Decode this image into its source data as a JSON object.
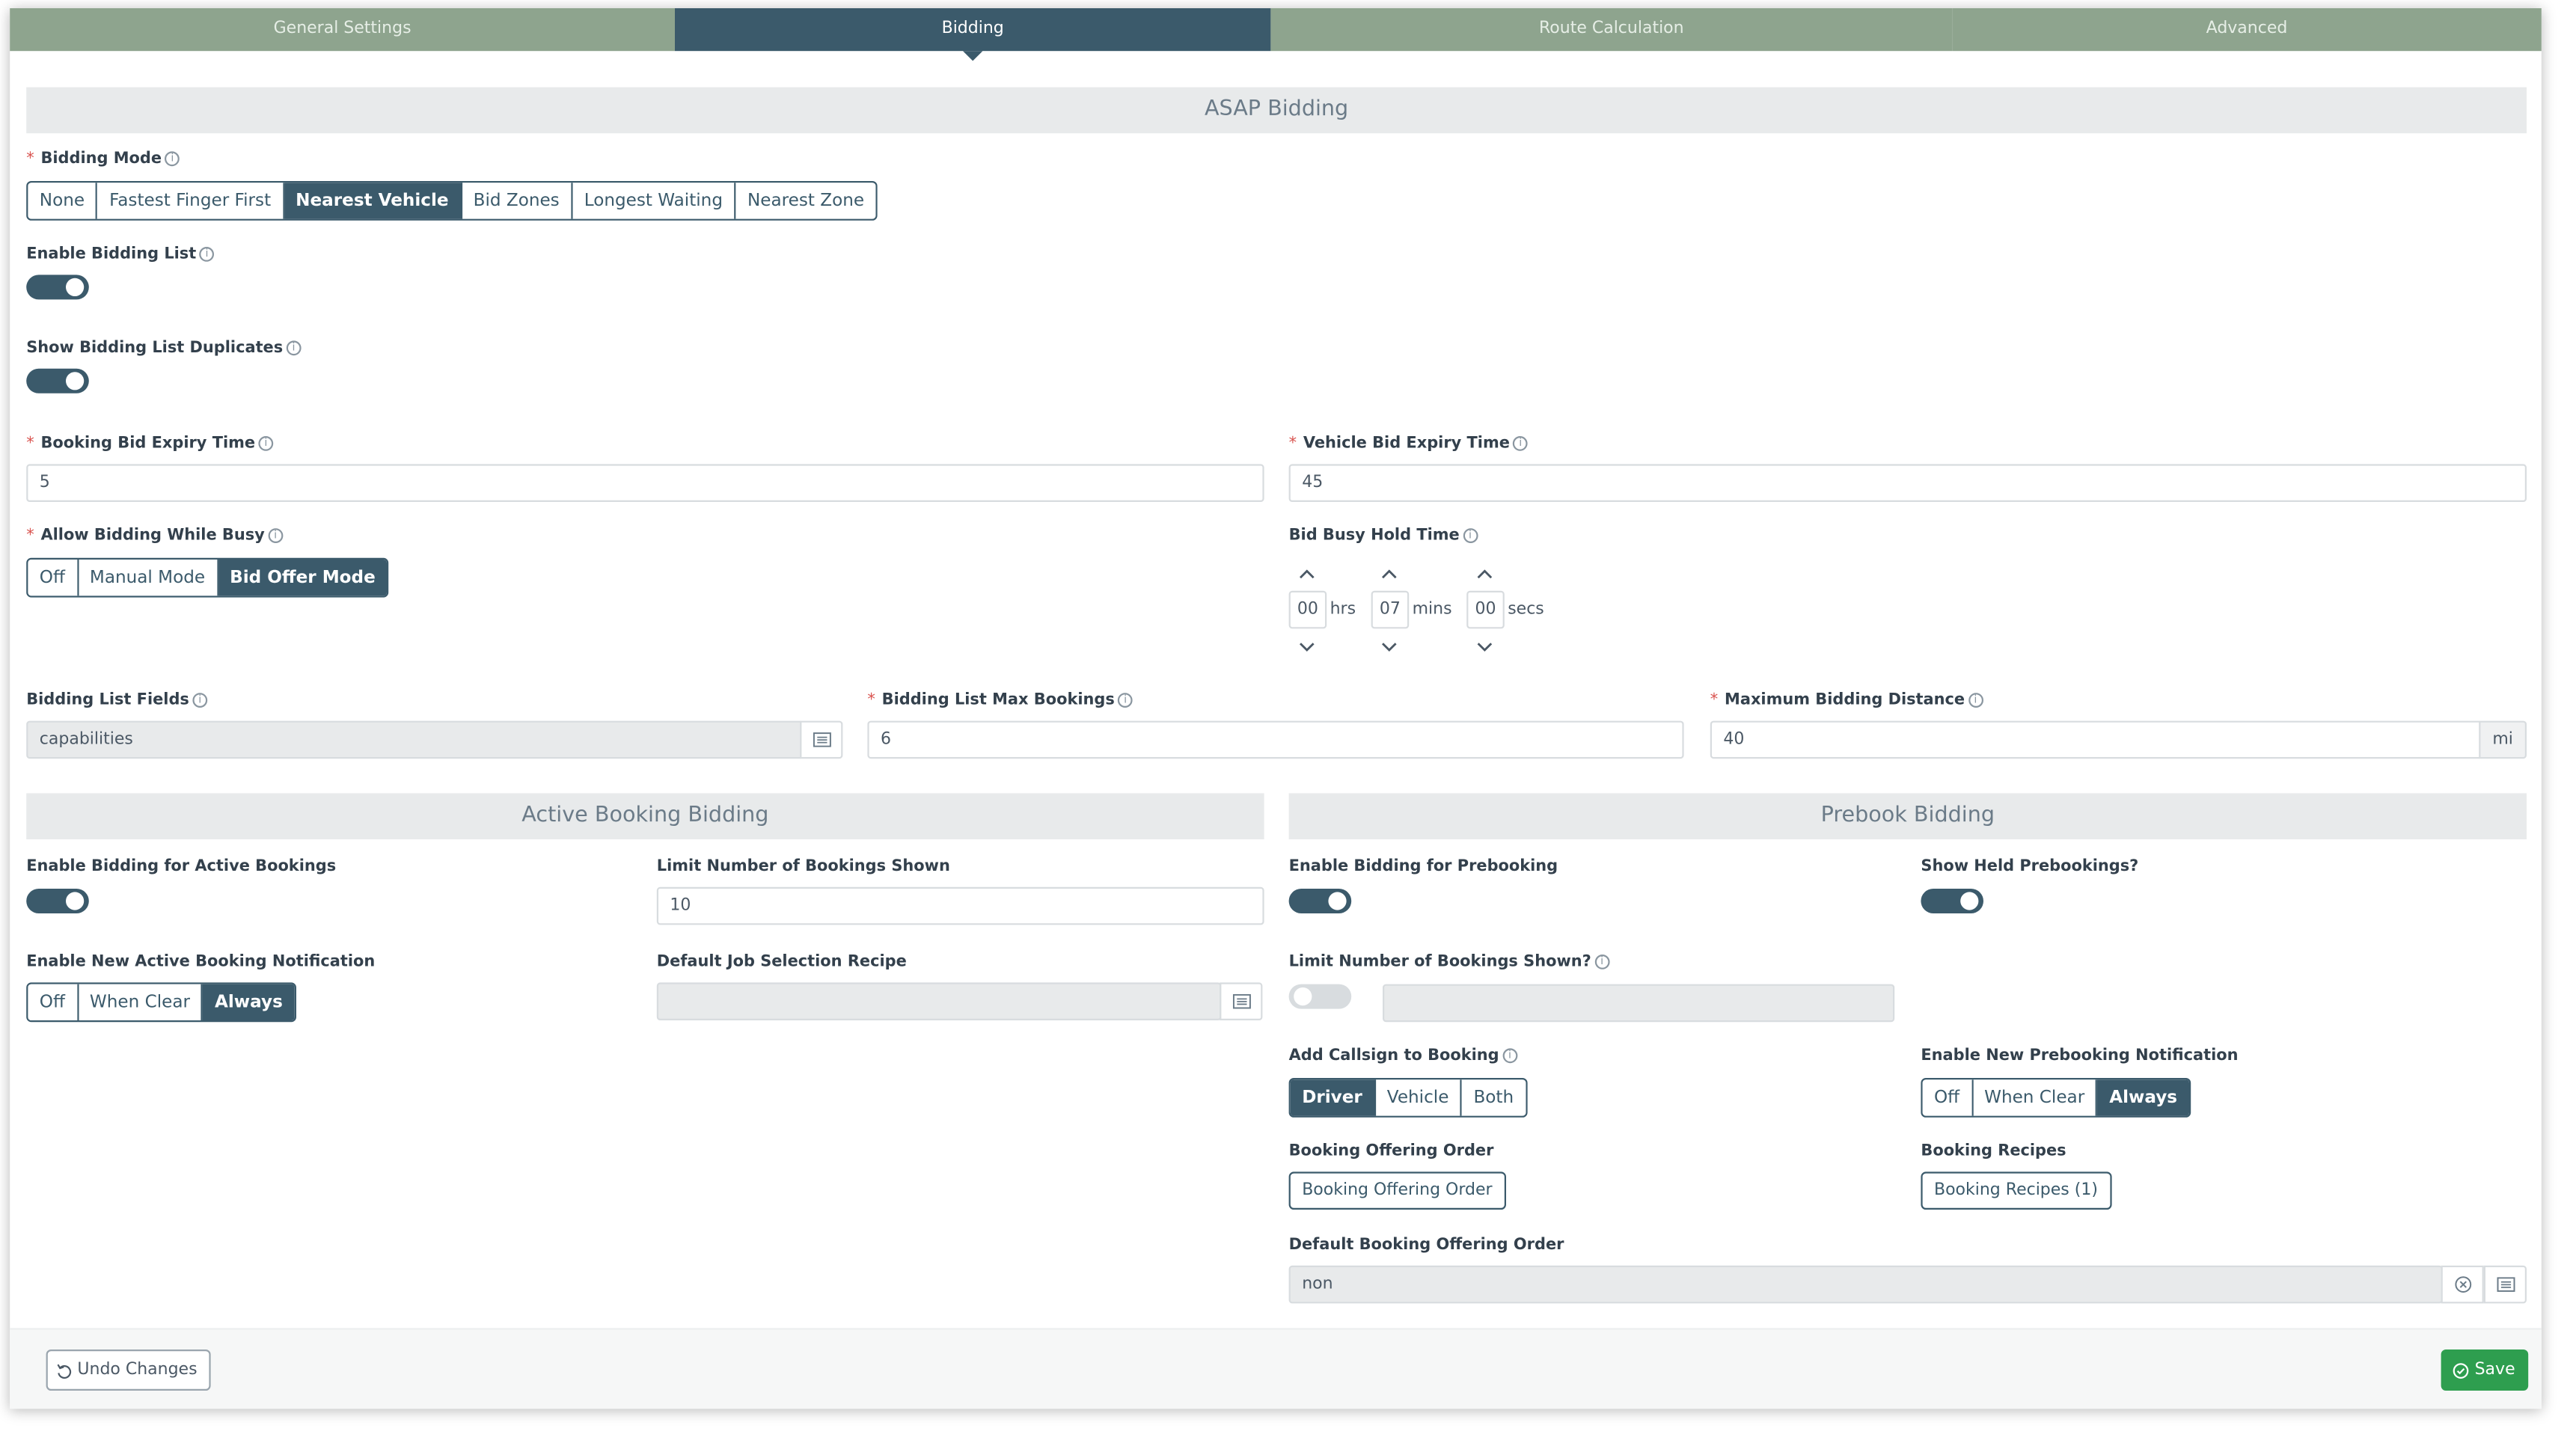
{
  "tabs": [
    {
      "label": "General Settings"
    },
    {
      "label": "Bidding",
      "active": true
    },
    {
      "label": "Route Calculation"
    },
    {
      "label": "Advanced"
    }
  ],
  "sections": {
    "asap": "ASAP Bidding",
    "active": "Active Booking Bidding",
    "prebook": "Prebook Bidding"
  },
  "bidding_mode": {
    "label": "Bidding Mode",
    "options": [
      "None",
      "Fastest Finger First",
      "Nearest Vehicle",
      "Bid Zones",
      "Longest Waiting",
      "Nearest Zone"
    ],
    "selected": "Nearest Vehicle"
  },
  "enable_bidding_list": {
    "label": "Enable Bidding List",
    "on": true
  },
  "show_duplicates": {
    "label": "Show Bidding List Duplicates",
    "on": true
  },
  "booking_bid_expiry": {
    "label": "Booking Bid Expiry Time",
    "value": "5"
  },
  "vehicle_bid_expiry": {
    "label": "Vehicle Bid Expiry Time",
    "value": "45"
  },
  "allow_bidding_busy": {
    "label": "Allow Bidding While Busy",
    "options": [
      "Off",
      "Manual Mode",
      "Bid Offer Mode"
    ],
    "selected": "Bid Offer Mode"
  },
  "bid_busy_hold": {
    "label": "Bid Busy Hold Time",
    "hours": "00",
    "hours_unit": "hrs",
    "mins": "07",
    "mins_unit": "mins",
    "secs": "00",
    "secs_unit": "secs"
  },
  "bidding_list_fields": {
    "label": "Bidding List Fields",
    "value": "capabilities"
  },
  "bidding_list_max": {
    "label": "Bidding List Max Bookings",
    "value": "6"
  },
  "max_bidding_distance": {
    "label": "Maximum Bidding Distance",
    "value": "40",
    "unit": "mi"
  },
  "active": {
    "enable": {
      "label": "Enable Bidding for Active Bookings",
      "on": true
    },
    "limit": {
      "label": "Limit Number of Bookings Shown",
      "value": "10"
    },
    "notification": {
      "label": "Enable New Active Booking Notification",
      "options": [
        "Off",
        "When Clear",
        "Always"
      ],
      "selected": "Always"
    },
    "recipe": {
      "label": "Default Job Selection Recipe",
      "value": ""
    }
  },
  "prebook": {
    "enable": {
      "label": "Enable Bidding for Prebooking",
      "on": true
    },
    "show_held": {
      "label": "Show Held Prebookings?",
      "on": true
    },
    "limit": {
      "label": "Limit Number of Bookings Shown?",
      "on": false
    },
    "callsign": {
      "label": "Add Callsign to Booking",
      "options": [
        "Driver",
        "Vehicle",
        "Both"
      ],
      "selected": "Driver"
    },
    "notification": {
      "label": "Enable New Prebooking Notification",
      "options": [
        "Off",
        "When Clear",
        "Always"
      ],
      "selected": "Always"
    },
    "offering_order": {
      "label": "Booking Offering Order",
      "button": "Booking Offering Order"
    },
    "recipes": {
      "label": "Booking Recipes",
      "button": "Booking Recipes (1)"
    },
    "default_offering_order": {
      "label": "Default Booking Offering Order",
      "value": "non"
    }
  },
  "footer": {
    "undo": "Undo Changes",
    "save": "Save"
  },
  "colors": {
    "primary": "#3b5a6b",
    "tab_inactive": "#8ea48e",
    "save": "#2e9e4f",
    "required": "#d9534f"
  }
}
